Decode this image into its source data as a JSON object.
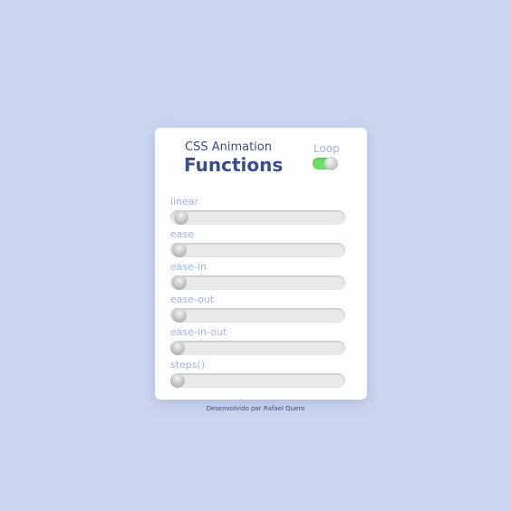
{
  "header": {
    "subtitle": "CSS Animation",
    "title": "Functions",
    "loop_label": "Loop",
    "loop_on": true
  },
  "colors": {
    "toggle_on": "#6de06a",
    "title": "#3a4d8a",
    "label": "#a5b2e0",
    "background": "#cbd5ee"
  },
  "rows": [
    {
      "label": "linear",
      "progress": 0.02
    },
    {
      "label": "ease",
      "progress": 0.01
    },
    {
      "label": "ease-in",
      "progress": 0.01
    },
    {
      "label": "ease-out",
      "progress": 0.01
    },
    {
      "label": "ease-in-out",
      "progress": 0.0
    },
    {
      "label": "steps()",
      "progress": 0.0
    }
  ],
  "footer": "Desenvolvido por Rafael Quero"
}
